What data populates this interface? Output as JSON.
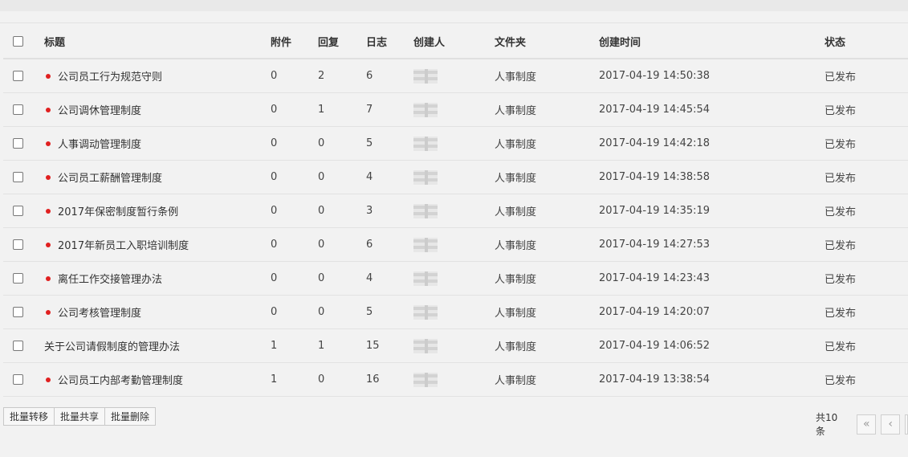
{
  "columns": {
    "title": "标题",
    "attachments": "附件",
    "replies": "回复",
    "logs": "日志",
    "creator": "创建人",
    "folder": "文件夹",
    "created_time": "创建时间",
    "status": "状态"
  },
  "rows": [
    {
      "title": "公司员工行为规范守则",
      "dot": true,
      "attachments": "0",
      "replies": "2",
      "logs": "6",
      "folder": "人事制度",
      "created_time": "2017-04-19 14:50:38",
      "status": "已发布"
    },
    {
      "title": "公司调休管理制度",
      "dot": true,
      "attachments": "0",
      "replies": "1",
      "logs": "7",
      "folder": "人事制度",
      "created_time": "2017-04-19 14:45:54",
      "status": "已发布"
    },
    {
      "title": "人事调动管理制度",
      "dot": true,
      "attachments": "0",
      "replies": "0",
      "logs": "5",
      "folder": "人事制度",
      "created_time": "2017-04-19 14:42:18",
      "status": "已发布"
    },
    {
      "title": "公司员工薪酬管理制度",
      "dot": true,
      "attachments": "0",
      "replies": "0",
      "logs": "4",
      "folder": "人事制度",
      "created_time": "2017-04-19 14:38:58",
      "status": "已发布"
    },
    {
      "title": "2017年保密制度暂行条例",
      "dot": true,
      "attachments": "0",
      "replies": "0",
      "logs": "3",
      "folder": "人事制度",
      "created_time": "2017-04-19 14:35:19",
      "status": "已发布"
    },
    {
      "title": "2017年新员工入职培训制度",
      "dot": true,
      "attachments": "0",
      "replies": "0",
      "logs": "6",
      "folder": "人事制度",
      "created_time": "2017-04-19 14:27:53",
      "status": "已发布"
    },
    {
      "title": "离任工作交接管理办法",
      "dot": true,
      "attachments": "0",
      "replies": "0",
      "logs": "4",
      "folder": "人事制度",
      "created_time": "2017-04-19 14:23:43",
      "status": "已发布"
    },
    {
      "title": "公司考核管理制度",
      "dot": true,
      "attachments": "0",
      "replies": "0",
      "logs": "5",
      "folder": "人事制度",
      "created_time": "2017-04-19 14:20:07",
      "status": "已发布"
    },
    {
      "title": "关于公司请假制度的管理办法",
      "dot": false,
      "attachments": "1",
      "replies": "1",
      "logs": "15",
      "folder": "人事制度",
      "created_time": "2017-04-19 14:06:52",
      "status": "已发布"
    },
    {
      "title": "公司员工内部考勤管理制度",
      "dot": true,
      "attachments": "1",
      "replies": "0",
      "logs": "16",
      "folder": "人事制度",
      "created_time": "2017-04-19 13:38:54",
      "status": "已发布"
    }
  ],
  "toolbar": {
    "batch_move": "批量转移",
    "batch_share": "批量共享",
    "batch_delete": "批量删除"
  },
  "pager": {
    "total": "共10条",
    "first": "«",
    "prev": "‹"
  },
  "colors": {
    "unread_dot": "#e02020",
    "background": "#f2f2f2"
  }
}
